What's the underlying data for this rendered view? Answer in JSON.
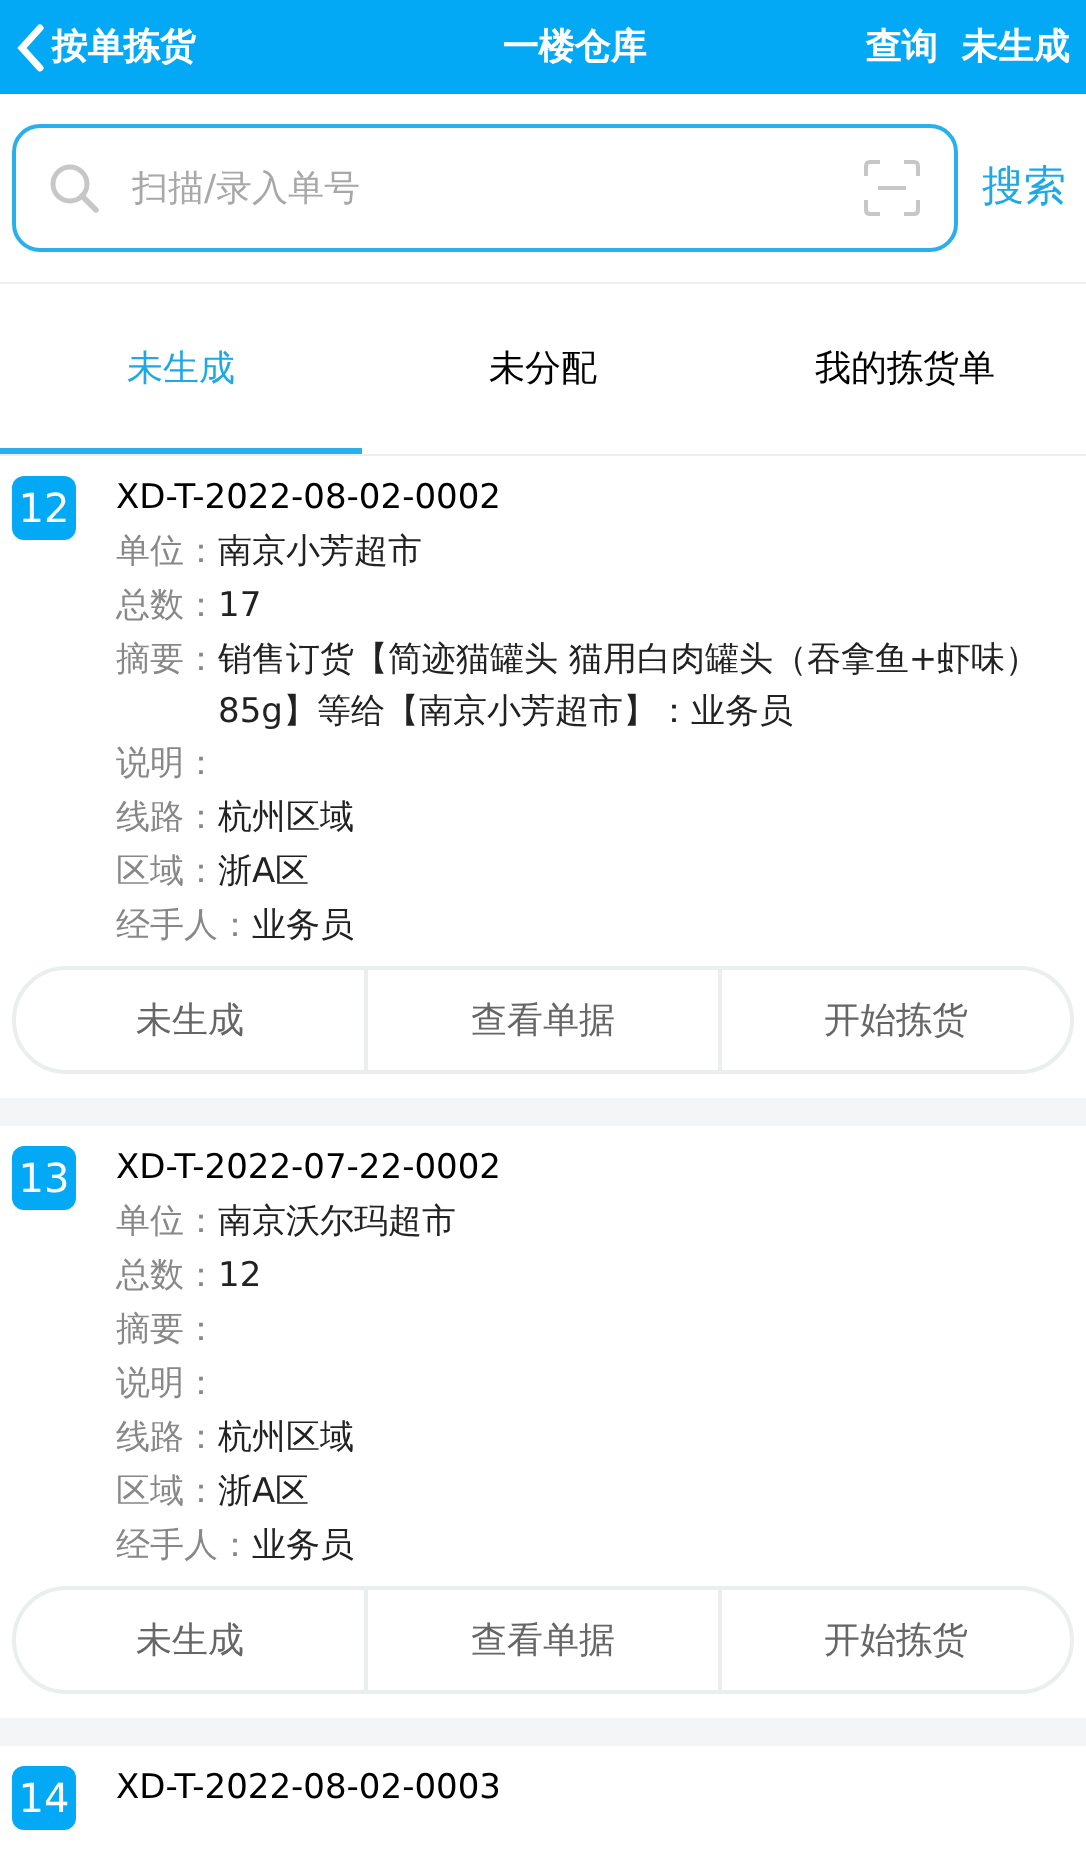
{
  "header": {
    "back_label": "按单拣货",
    "title": "一楼仓库",
    "actions": [
      "查询",
      "未生成"
    ]
  },
  "search": {
    "placeholder": "扫描/录入单号",
    "button": "搜索"
  },
  "tabs": [
    {
      "label": "未生成",
      "selected": true
    },
    {
      "label": "未分配",
      "selected": false
    },
    {
      "label": "我的拣货单",
      "selected": false
    }
  ],
  "orders": [
    {
      "index": "12",
      "number": "XD-T-2022-08-02-0002",
      "fields": [
        {
          "label": "单位：",
          "value": "南京小芳超市"
        },
        {
          "label": "总数：",
          "value": "17"
        },
        {
          "label": "摘要：",
          "value": "销售订货【简迹猫罐头 猫用白肉罐头（吞拿鱼+虾味）85g】等给【南京小芳超市】：业务员"
        },
        {
          "label": "说明："
        },
        {
          "label": "线路：",
          "value": "杭州区域"
        },
        {
          "label": "区域：",
          "value": "浙A区"
        },
        {
          "label": "经手人：",
          "value": "业务员"
        }
      ],
      "buttons": [
        "未生成",
        "查看单据",
        "开始拣货"
      ]
    },
    {
      "index": "13",
      "number": "XD-T-2022-07-22-0002",
      "fields": [
        {
          "label": "单位：",
          "value": "南京沃尔玛超市"
        },
        {
          "label": "总数：",
          "value": "12"
        },
        {
          "label": "摘要："
        },
        {
          "label": "说明："
        },
        {
          "label": "线路：",
          "value": "杭州区域"
        },
        {
          "label": "区域：",
          "value": "浙A区"
        },
        {
          "label": "经手人：",
          "value": "业务员"
        }
      ],
      "buttons": [
        "未生成",
        "查看单据",
        "开始拣货"
      ]
    },
    {
      "index": "14",
      "number": "XD-T-2022-08-02-0003"
    }
  ]
}
